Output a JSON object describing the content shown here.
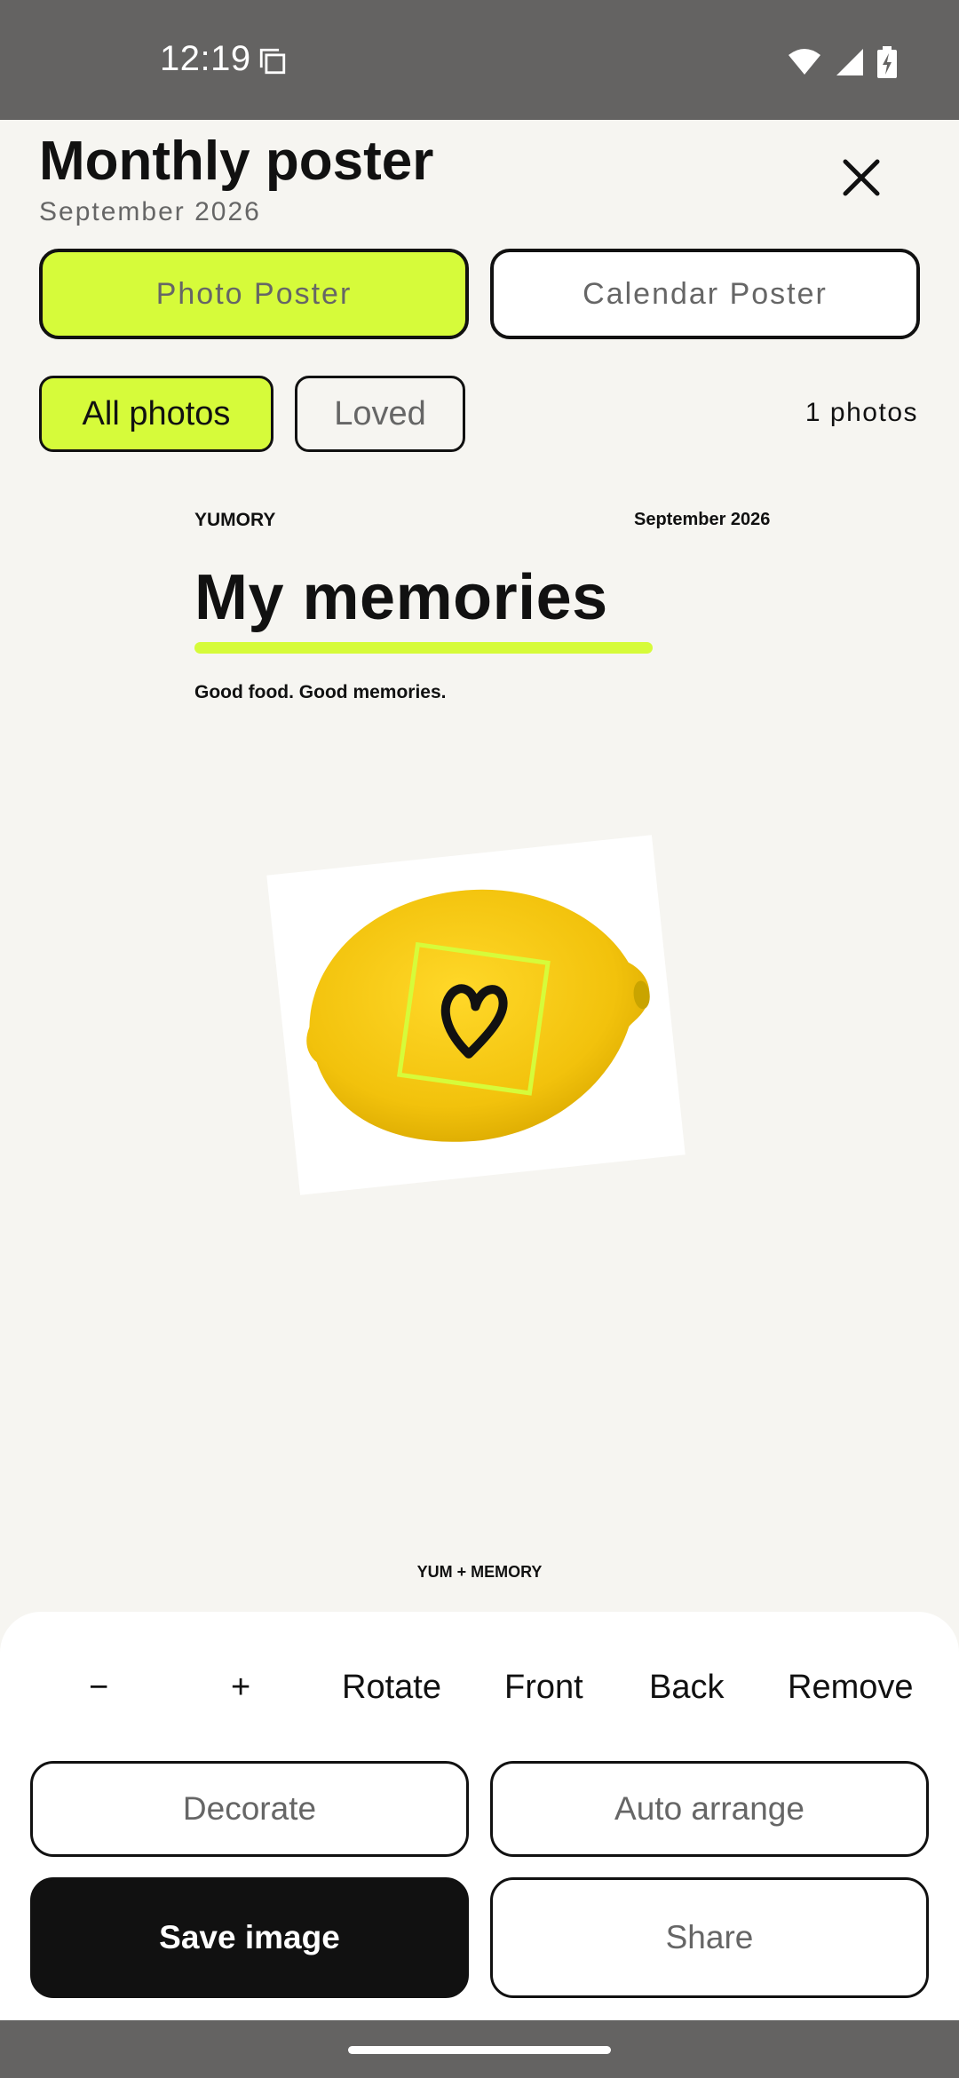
{
  "status_bar": {
    "time": "12:19",
    "icons": [
      "copy-icon",
      "wifi-icon",
      "signal-icon",
      "battery-charging-icon"
    ]
  },
  "header": {
    "title": "Monthly poster",
    "subtitle": "September 2026",
    "close_icon": "close-icon"
  },
  "poster_type": {
    "options": [
      "Photo Poster",
      "Calendar Poster"
    ],
    "selected": "Photo Poster"
  },
  "filter": {
    "options": [
      "All photos",
      "Loved"
    ],
    "selected": "All photos",
    "count_label": "1 photos"
  },
  "poster": {
    "brand": "YUMORY",
    "date": "September 2026",
    "title": "My memories",
    "tagline": "Good food. Good memories.",
    "footer": "YUM + MEMORY",
    "photo_icon": "heart-icon"
  },
  "tools": {
    "minus": "−",
    "plus": "+",
    "rotate": "Rotate",
    "front": "Front",
    "back": "Back",
    "remove": "Remove"
  },
  "actions": {
    "decorate": "Decorate",
    "auto_arrange": "Auto arrange",
    "save": "Save image",
    "share": "Share"
  },
  "colors": {
    "accent": "#d6fb3a",
    "dark": "#111111",
    "background": "#f6f5f1",
    "system_bar": "#646362"
  }
}
